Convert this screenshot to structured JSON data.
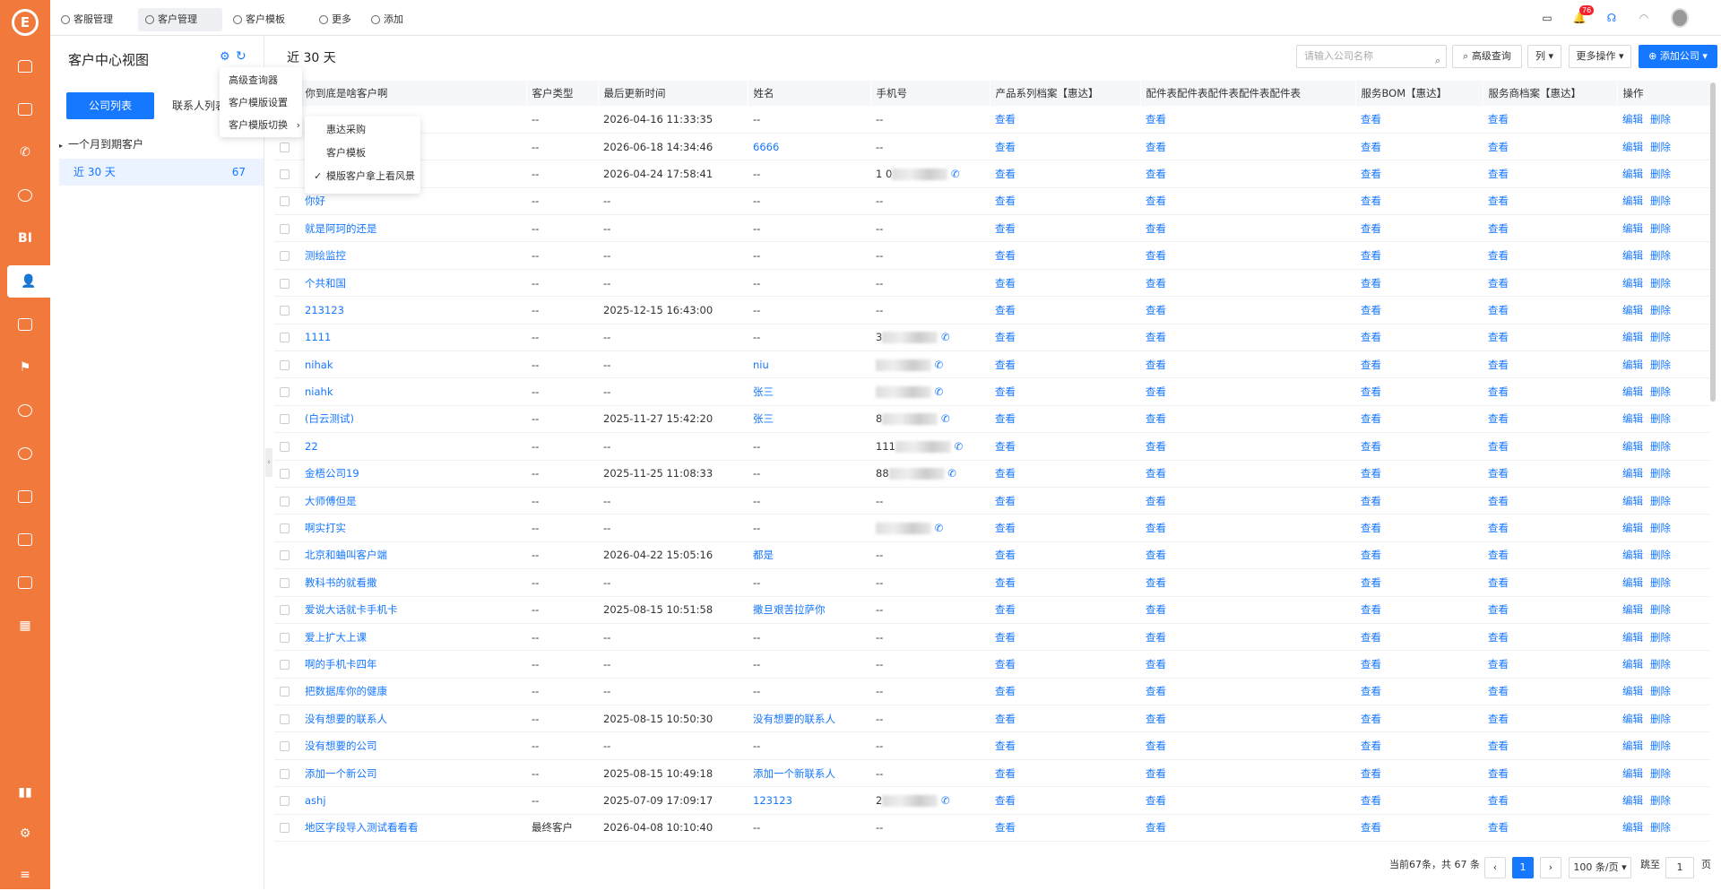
{
  "rail": {
    "logo": "E",
    "items": [
      "home-icon",
      "document-icon",
      "phone-icon",
      "chat-icon",
      "bi-icon",
      "customer-icon",
      "form-icon",
      "flag-icon",
      "service-icon",
      "service2-icon",
      "book-icon",
      "book2-icon",
      "ticket-icon",
      "apps-icon",
      "chart-icon",
      "settings-icon",
      "menu-icon"
    ],
    "bi_label": "BI"
  },
  "tabs": [
    {
      "label": "客服管理",
      "icon": "gear-icon"
    },
    {
      "label": "客户管理",
      "icon": "user-icon"
    },
    {
      "label": "客户模板",
      "icon": "user-icon"
    }
  ],
  "more_label": "更多",
  "add_label": "添加",
  "notify_count": "76",
  "left": {
    "title": "客户中心视图",
    "btn_company": "公司列表",
    "btn_contact": "联系人列表",
    "tree": [
      {
        "label": "一个月到期客户",
        "count": ""
      },
      {
        "label": "近 30 天",
        "count": "67"
      }
    ]
  },
  "dropdown": {
    "items": [
      "高级查询器",
      "客户模版设置",
      "客户模版切换"
    ]
  },
  "submenu": {
    "items": [
      "惠达采购",
      "客户模板",
      "模版客户拿上看风景"
    ],
    "checked": 2
  },
  "main": {
    "title": "近 30 天",
    "search_placeholder": "请输入公司名称",
    "adv_search": "高级查询",
    "columns_btn": "列",
    "more_ops": "更多操作",
    "add_company": "添加公司"
  },
  "table": {
    "headers": [
      "你到底是啥客户啊",
      "客户类型",
      "最后更新时间",
      "姓名",
      "手机号",
      "产品系列档案【惠达】",
      "配件表配件表配件表配件表配件表",
      "服务BOM【惠达】",
      "服务商档案【惠达】",
      "操作"
    ],
    "view_label": "查看",
    "edit_label": "编辑",
    "delete_label": "删除",
    "rows": [
      {
        "name": "",
        "type": "--",
        "time": "2026-04-16 11:33:35",
        "person": "--",
        "phone": "--"
      },
      {
        "name": "",
        "type": "--",
        "time": "2026-06-18 14:34:46",
        "person": "6666",
        "phone": "--"
      },
      {
        "name": "",
        "type": "--",
        "time": "2026-04-24 17:58:41",
        "person": "--",
        "phone": "1 0"
      },
      {
        "name": "你好",
        "type": "--",
        "time": "--",
        "person": "--",
        "phone": "--"
      },
      {
        "name": "就是阿珂的还是",
        "type": "--",
        "time": "--",
        "person": "--",
        "phone": "--"
      },
      {
        "name": "测绘监控",
        "type": "--",
        "time": "--",
        "person": "--",
        "phone": "--"
      },
      {
        "name": "个共和国",
        "type": "--",
        "time": "--",
        "person": "--",
        "phone": "--"
      },
      {
        "name": "213123",
        "type": "--",
        "time": "2025-12-15 16:43:00",
        "person": "--",
        "phone": "--"
      },
      {
        "name": "1111",
        "type": "--",
        "time": "--",
        "person": "--",
        "phone": "3"
      },
      {
        "name": "nihak",
        "type": "--",
        "time": "--",
        "person": "niu",
        "phone": ""
      },
      {
        "name": "niahk",
        "type": "--",
        "time": "--",
        "person": "张三",
        "phone": ""
      },
      {
        "name": "(白云测试)",
        "type": "--",
        "time": "2025-11-27 15:42:20",
        "person": "张三",
        "phone": "8"
      },
      {
        "name": "22",
        "type": "--",
        "time": "--",
        "person": "--",
        "phone": "111"
      },
      {
        "name": "金梧公司19",
        "type": "--",
        "time": "2025-11-25 11:08:33",
        "person": "--",
        "phone": "88"
      },
      {
        "name": "大师傅但是",
        "type": "--",
        "time": "--",
        "person": "--",
        "phone": "--"
      },
      {
        "name": "啊实打实",
        "type": "--",
        "time": "--",
        "person": "--",
        "phone": ""
      },
      {
        "name": "北京和蛐叫客户端",
        "type": "--",
        "time": "2026-04-22 15:05:16",
        "person": "都是",
        "phone": "--"
      },
      {
        "name": "教科书的就看撒",
        "type": "--",
        "time": "--",
        "person": "--",
        "phone": "--"
      },
      {
        "name": "爱说大话就卡手机卡",
        "type": "--",
        "time": "2025-08-15 10:51:58",
        "person": "撒旦艰苦拉萨你",
        "phone": "--"
      },
      {
        "name": "爱上扩大上课",
        "type": "--",
        "time": "--",
        "person": "--",
        "phone": "--"
      },
      {
        "name": "啊的手机卡四年",
        "type": "--",
        "time": "--",
        "person": "--",
        "phone": "--"
      },
      {
        "name": "把数据库你的健康",
        "type": "--",
        "time": "--",
        "person": "--",
        "phone": "--"
      },
      {
        "name": "没有想要的联系人",
        "type": "--",
        "time": "2025-08-15 10:50:30",
        "person": "没有想要的联系人",
        "phone": "--"
      },
      {
        "name": "没有想要的公司",
        "type": "--",
        "time": "--",
        "person": "--",
        "phone": "--"
      },
      {
        "name": "添加一个新公司",
        "type": "--",
        "time": "2025-08-15 10:49:18",
        "person": "添加一个新联系人",
        "phone": "--"
      },
      {
        "name": "ashj",
        "type": "--",
        "time": "2025-07-09 17:09:17",
        "person": "123123",
        "phone": "2"
      },
      {
        "name": "地区字段导入测试看看看",
        "type": "最终客户",
        "time": "2026-04-08 10:10:40",
        "person": "--",
        "phone": "--"
      }
    ]
  },
  "pager": {
    "summary": "当前67条，共 67 条",
    "current": "1",
    "page_size": "100 条/页",
    "goto_label": "跳至",
    "goto_value": "1",
    "page_suffix": "页"
  }
}
